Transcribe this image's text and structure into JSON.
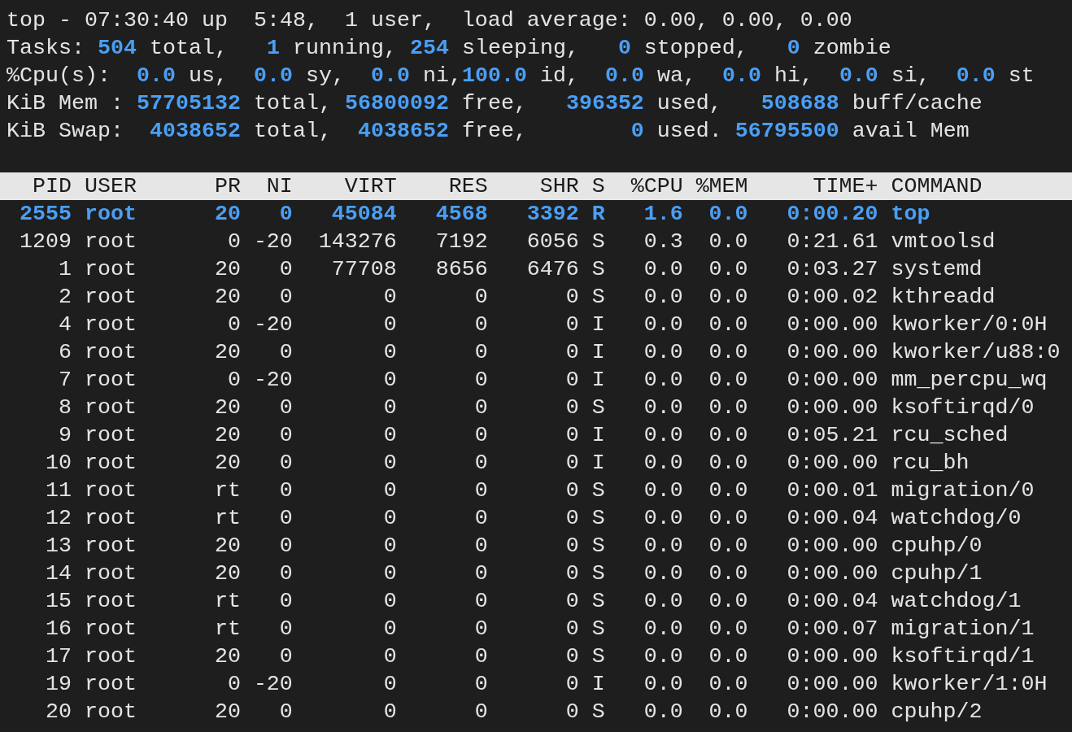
{
  "summary": [
    [
      {
        "kind": "label",
        "text": "top - 07:30:40 up  5:48,  1 user,  load average: 0.00, 0.00, 0.00"
      }
    ],
    [
      {
        "kind": "label",
        "text": "Tasks: "
      },
      {
        "kind": "value",
        "text": "504"
      },
      {
        "kind": "label",
        "text": " total,   "
      },
      {
        "kind": "value",
        "text": "1"
      },
      {
        "kind": "label",
        "text": " running, "
      },
      {
        "kind": "value",
        "text": "254"
      },
      {
        "kind": "label",
        "text": " sleeping,   "
      },
      {
        "kind": "value",
        "text": "0"
      },
      {
        "kind": "label",
        "text": " stopped,   "
      },
      {
        "kind": "value",
        "text": "0"
      },
      {
        "kind": "label",
        "text": " zombie"
      }
    ],
    [
      {
        "kind": "label",
        "text": "%Cpu(s):  "
      },
      {
        "kind": "value",
        "text": "0.0"
      },
      {
        "kind": "label",
        "text": " us,  "
      },
      {
        "kind": "value",
        "text": "0.0"
      },
      {
        "kind": "label",
        "text": " sy,  "
      },
      {
        "kind": "value",
        "text": "0.0"
      },
      {
        "kind": "label",
        "text": " ni,"
      },
      {
        "kind": "value",
        "text": "100.0"
      },
      {
        "kind": "label",
        "text": " id,  "
      },
      {
        "kind": "value",
        "text": "0.0"
      },
      {
        "kind": "label",
        "text": " wa,  "
      },
      {
        "kind": "value",
        "text": "0.0"
      },
      {
        "kind": "label",
        "text": " hi,  "
      },
      {
        "kind": "value",
        "text": "0.0"
      },
      {
        "kind": "label",
        "text": " si,  "
      },
      {
        "kind": "value",
        "text": "0.0"
      },
      {
        "kind": "label",
        "text": " st"
      }
    ],
    [
      {
        "kind": "label",
        "text": "KiB Mem : "
      },
      {
        "kind": "value",
        "text": "57705132"
      },
      {
        "kind": "label",
        "text": " total, "
      },
      {
        "kind": "value",
        "text": "56800092"
      },
      {
        "kind": "label",
        "text": " free,   "
      },
      {
        "kind": "value",
        "text": "396352"
      },
      {
        "kind": "label",
        "text": " used,   "
      },
      {
        "kind": "value",
        "text": "508688"
      },
      {
        "kind": "label",
        "text": " buff/cache"
      }
    ],
    [
      {
        "kind": "label",
        "text": "KiB Swap:  "
      },
      {
        "kind": "value",
        "text": "4038652"
      },
      {
        "kind": "label",
        "text": " total,  "
      },
      {
        "kind": "value",
        "text": "4038652"
      },
      {
        "kind": "label",
        "text": " free,        "
      },
      {
        "kind": "value",
        "text": "0"
      },
      {
        "kind": "label",
        "text": " used. "
      },
      {
        "kind": "value",
        "text": "56795500"
      },
      {
        "kind": "label",
        "text": " avail Mem"
      }
    ]
  ],
  "table": {
    "columns": [
      "PID",
      "USER",
      "PR",
      "NI",
      "VIRT",
      "RES",
      "SHR",
      "S",
      "%CPU",
      "%MEM",
      "TIME+",
      "COMMAND"
    ],
    "rows": [
      {
        "selected": true,
        "cells": [
          "2555",
          "root",
          "20",
          "0",
          "45084",
          "4568",
          "3392",
          "R",
          "1.6",
          "0.0",
          "0:00.20",
          "top"
        ]
      },
      {
        "selected": false,
        "cells": [
          "1209",
          "root",
          "0",
          "-20",
          "143276",
          "7192",
          "6056",
          "S",
          "0.3",
          "0.0",
          "0:21.61",
          "vmtoolsd"
        ]
      },
      {
        "selected": false,
        "cells": [
          "1",
          "root",
          "20",
          "0",
          "77708",
          "8656",
          "6476",
          "S",
          "0.0",
          "0.0",
          "0:03.27",
          "systemd"
        ]
      },
      {
        "selected": false,
        "cells": [
          "2",
          "root",
          "20",
          "0",
          "0",
          "0",
          "0",
          "S",
          "0.0",
          "0.0",
          "0:00.02",
          "kthreadd"
        ]
      },
      {
        "selected": false,
        "cells": [
          "4",
          "root",
          "0",
          "-20",
          "0",
          "0",
          "0",
          "I",
          "0.0",
          "0.0",
          "0:00.00",
          "kworker/0:0H"
        ]
      },
      {
        "selected": false,
        "cells": [
          "6",
          "root",
          "20",
          "0",
          "0",
          "0",
          "0",
          "I",
          "0.0",
          "0.0",
          "0:00.00",
          "kworker/u88:0"
        ]
      },
      {
        "selected": false,
        "cells": [
          "7",
          "root",
          "0",
          "-20",
          "0",
          "0",
          "0",
          "I",
          "0.0",
          "0.0",
          "0:00.00",
          "mm_percpu_wq"
        ]
      },
      {
        "selected": false,
        "cells": [
          "8",
          "root",
          "20",
          "0",
          "0",
          "0",
          "0",
          "S",
          "0.0",
          "0.0",
          "0:00.00",
          "ksoftirqd/0"
        ]
      },
      {
        "selected": false,
        "cells": [
          "9",
          "root",
          "20",
          "0",
          "0",
          "0",
          "0",
          "I",
          "0.0",
          "0.0",
          "0:05.21",
          "rcu_sched"
        ]
      },
      {
        "selected": false,
        "cells": [
          "10",
          "root",
          "20",
          "0",
          "0",
          "0",
          "0",
          "I",
          "0.0",
          "0.0",
          "0:00.00",
          "rcu_bh"
        ]
      },
      {
        "selected": false,
        "cells": [
          "11",
          "root",
          "rt",
          "0",
          "0",
          "0",
          "0",
          "S",
          "0.0",
          "0.0",
          "0:00.01",
          "migration/0"
        ]
      },
      {
        "selected": false,
        "cells": [
          "12",
          "root",
          "rt",
          "0",
          "0",
          "0",
          "0",
          "S",
          "0.0",
          "0.0",
          "0:00.04",
          "watchdog/0"
        ]
      },
      {
        "selected": false,
        "cells": [
          "13",
          "root",
          "20",
          "0",
          "0",
          "0",
          "0",
          "S",
          "0.0",
          "0.0",
          "0:00.00",
          "cpuhp/0"
        ]
      },
      {
        "selected": false,
        "cells": [
          "14",
          "root",
          "20",
          "0",
          "0",
          "0",
          "0",
          "S",
          "0.0",
          "0.0",
          "0:00.00",
          "cpuhp/1"
        ]
      },
      {
        "selected": false,
        "cells": [
          "15",
          "root",
          "rt",
          "0",
          "0",
          "0",
          "0",
          "S",
          "0.0",
          "0.0",
          "0:00.04",
          "watchdog/1"
        ]
      },
      {
        "selected": false,
        "cells": [
          "16",
          "root",
          "rt",
          "0",
          "0",
          "0",
          "0",
          "S",
          "0.0",
          "0.0",
          "0:00.07",
          "migration/1"
        ]
      },
      {
        "selected": false,
        "cells": [
          "17",
          "root",
          "20",
          "0",
          "0",
          "0",
          "0",
          "S",
          "0.0",
          "0.0",
          "0:00.00",
          "ksoftirqd/1"
        ]
      },
      {
        "selected": false,
        "cells": [
          "19",
          "root",
          "0",
          "-20",
          "0",
          "0",
          "0",
          "I",
          "0.0",
          "0.0",
          "0:00.00",
          "kworker/1:0H"
        ]
      },
      {
        "selected": false,
        "cells": [
          "20",
          "root",
          "20",
          "0",
          "0",
          "0",
          "0",
          "S",
          "0.0",
          "0.0",
          "0:00.00",
          "cpuhp/2"
        ]
      }
    ]
  }
}
